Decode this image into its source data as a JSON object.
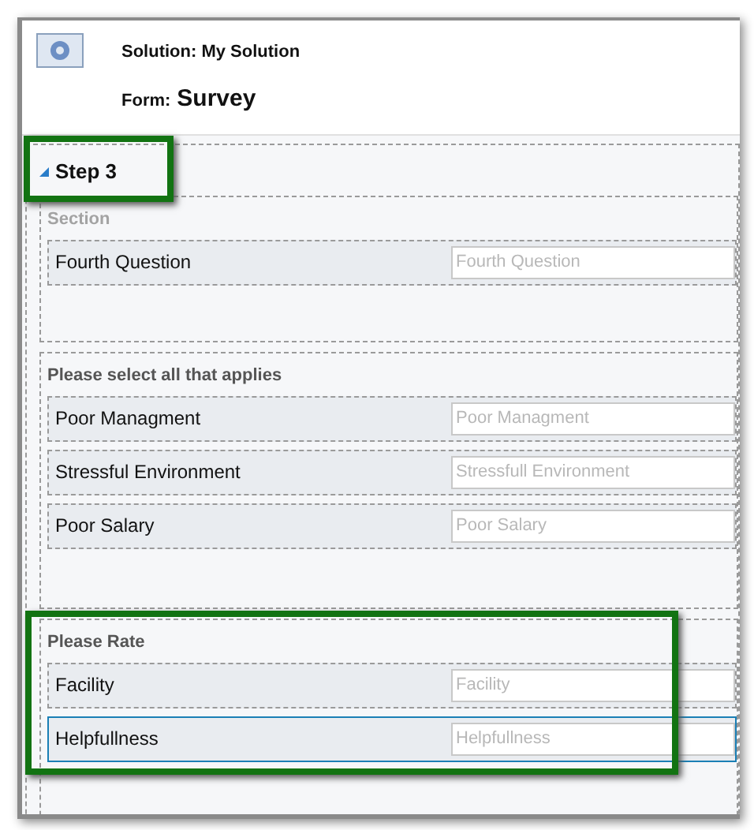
{
  "header": {
    "solution": "Solution: My Solution",
    "form_label": "Form:",
    "form_name": "Survey"
  },
  "tab": {
    "title": "Step 3",
    "expanded": true,
    "highlighted": true
  },
  "sections": [
    {
      "title": "Section",
      "dimmed": true,
      "highlighted": false,
      "fields": [
        {
          "label": "Fourth Question",
          "placeholder": "Fourth Question",
          "selected": false
        }
      ]
    },
    {
      "title": "Please select all that applies",
      "dimmed": false,
      "highlighted": false,
      "fields": [
        {
          "label": "Poor Managment",
          "placeholder": "Poor Managment",
          "selected": false
        },
        {
          "label": "Stressful Environment",
          "placeholder": "Stressfull Environment",
          "selected": false
        },
        {
          "label": "Poor Salary",
          "placeholder": "Poor Salary",
          "selected": false
        }
      ]
    },
    {
      "title": "Please Rate",
      "dimmed": false,
      "highlighted": true,
      "fields": [
        {
          "label": "Facility",
          "placeholder": "Facility",
          "selected": false
        },
        {
          "label": "Helpfullness",
          "placeholder": "Helpfullness",
          "selected": true
        }
      ]
    }
  ]
}
